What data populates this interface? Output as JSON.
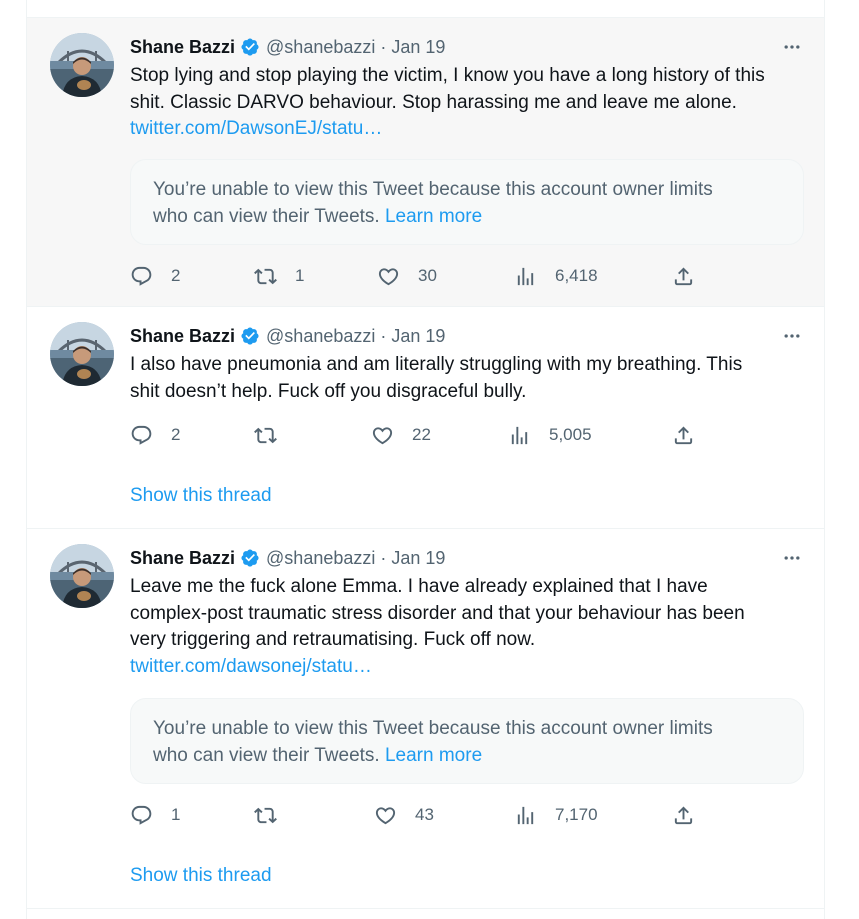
{
  "tweets": [
    {
      "author": {
        "name": "Shane Bazzi",
        "handle": "@shanebazzi",
        "verified": true
      },
      "date": "Jan 19",
      "lines": [
        "Stop lying and stop playing the victim, I know you have a long history of this",
        "shit. Classic DARVO behaviour. Stop harassing me and leave me alone."
      ],
      "link": "twitter.com/DawsonEJ/statu…",
      "quote": {
        "line1": "You’re unable to view this Tweet because this account owner limits",
        "line2": "who can view their Tweets.",
        "learn_more": "Learn more"
      },
      "stats": {
        "replies": "2",
        "retweets": "1",
        "likes": "30",
        "views": "6,418"
      },
      "highlighted": true
    },
    {
      "author": {
        "name": "Shane Bazzi",
        "handle": "@shanebazzi",
        "verified": true
      },
      "date": "Jan 19",
      "lines": [
        "I also have pneumonia and am literally struggling with my breathing. This",
        "shit doesn’t help. Fuck off you disgraceful bully."
      ],
      "stats": {
        "replies": "2",
        "retweets": "",
        "likes": "22",
        "views": "5,005"
      },
      "show_thread": "Show this thread"
    },
    {
      "author": {
        "name": "Shane Bazzi",
        "handle": "@shanebazzi",
        "verified": true
      },
      "date": "Jan 19",
      "lines": [
        "Leave me the fuck alone Emma. I have already explained that I have",
        "complex-post traumatic stress disorder and that your behaviour has been",
        "very triggering and retraumatising. Fuck off now."
      ],
      "link": "twitter.com/dawsonej/statu…",
      "quote": {
        "line1": "You’re unable to view this Tweet because this account owner limits",
        "line2": "who can view their Tweets.",
        "learn_more": "Learn more"
      },
      "stats": {
        "replies": "1",
        "retweets": "",
        "likes": "43",
        "views": "7,170"
      },
      "show_thread": "Show this thread"
    }
  ],
  "icons": {
    "reply": "reply-icon",
    "retweet": "retweet-icon",
    "like": "heart-icon",
    "views": "views-icon",
    "share": "share-icon",
    "more": "more-icon",
    "verified": "verified-badge-icon"
  },
  "colors": {
    "accent": "#1d9bf0",
    "muted": "#536471",
    "text": "#0f1419",
    "highlight_bg": "#f7f7f7"
  }
}
